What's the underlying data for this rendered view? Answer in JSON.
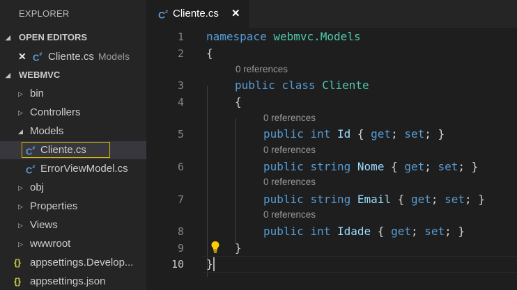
{
  "sidebar": {
    "title": "EXPLORER",
    "open_editors": {
      "header": "OPEN EDITORS",
      "items": [
        {
          "name": "Cliente.cs",
          "folder": "Models"
        }
      ]
    },
    "project": {
      "header": "WEBMVC",
      "items": [
        {
          "label": "bin"
        },
        {
          "label": "Controllers"
        },
        {
          "label": "Models"
        },
        {
          "label": "Cliente.cs"
        },
        {
          "label": "ErrorViewModel.cs"
        },
        {
          "label": "obj"
        },
        {
          "label": "Properties"
        },
        {
          "label": "Views"
        },
        {
          "label": "wwwroot"
        },
        {
          "label": "appsettings.Develop..."
        },
        {
          "label": "appsettings.json"
        }
      ]
    }
  },
  "tabs": [
    {
      "label": "Cliente.cs",
      "close": "✕"
    }
  ],
  "editor": {
    "line_numbers": [
      "1",
      "2",
      "3",
      "4",
      "5",
      "6",
      "7",
      "8",
      "9",
      "10"
    ],
    "code_lens": "0 references",
    "lines": [
      {
        "t": [
          "namespace",
          " ",
          "webmvc.Models"
        ]
      },
      {
        "t": [
          "{"
        ]
      },
      {
        "t": [
          "public",
          " ",
          "class",
          " ",
          "Cliente"
        ]
      },
      {
        "t": [
          "{"
        ]
      },
      {
        "t": [
          "public",
          " ",
          "int",
          " ",
          "Id",
          " { ",
          "get",
          "; ",
          "set",
          "; }"
        ]
      },
      {
        "t": [
          "public",
          " ",
          "string",
          " ",
          "Nome",
          " { ",
          "get",
          "; ",
          "set",
          "; }"
        ]
      },
      {
        "t": [
          "public",
          " ",
          "string",
          " ",
          "Email",
          " { ",
          "get",
          "; ",
          "set",
          "; }"
        ]
      },
      {
        "t": [
          "public",
          " ",
          "int",
          " ",
          "Idade",
          " { ",
          "get",
          "; ",
          "set",
          "; }"
        ]
      },
      {
        "t": [
          "}"
        ]
      },
      {
        "t": [
          "}"
        ]
      }
    ]
  },
  "colors": {
    "keyword": "#569cd6",
    "type": "#4ec9b0",
    "property": "#9cdcfe",
    "lightbulb": "#ffcc00",
    "focus_border": "#d7ba00"
  }
}
